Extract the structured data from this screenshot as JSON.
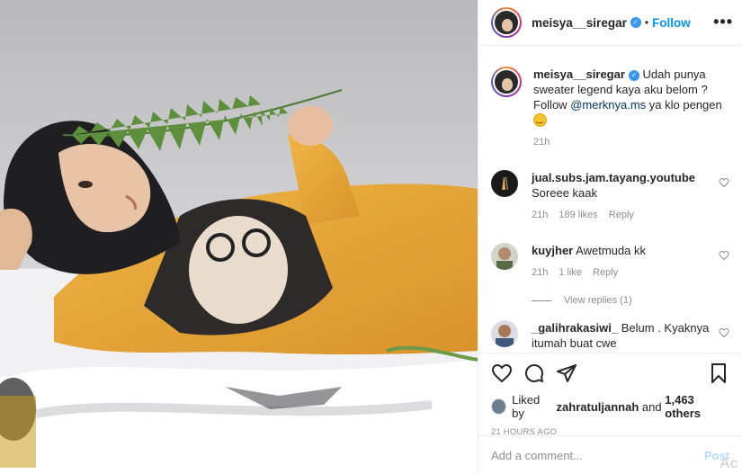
{
  "header": {
    "username": "meisya__siregar",
    "separator": "•",
    "follow_label": "Follow",
    "more_label": "•••"
  },
  "caption": {
    "username": "meisya__siregar",
    "text_before": "Udah punya sweater legend kaya aku belom ? Follow ",
    "mention": "@merknya.ms",
    "text_after": " ya klo pengen",
    "time": "21h"
  },
  "comments": [
    {
      "username": "jual.subs.jam.tayang.youtube",
      "text": "Soreee kaak",
      "time": "21h",
      "likes": "189 likes",
      "reply_label": "Reply"
    },
    {
      "username": "kuyjher",
      "text": "Awetmuda kk",
      "time": "21h",
      "likes": "1 like",
      "reply_label": "Reply",
      "view_replies": "View replies (1)"
    },
    {
      "username": "_galihrakasiwi_",
      "text": "Belum . Kyaknya itumah buat cwe"
    }
  ],
  "likes": {
    "prefix": "Liked by",
    "user": "zahratuljannah",
    "middle": "and",
    "count": "1,463 others"
  },
  "timestamp": "21 HOURS AGO",
  "add_comment": {
    "placeholder": "Add a comment...",
    "post_label": "Post"
  },
  "watermark": "Ac",
  "colors": {
    "accent": "#0095f6",
    "verified": "#3897f0",
    "sweater": "#e8a83a",
    "hijab": "#1f1f22"
  },
  "icons": {
    "like": "heart-icon",
    "comment": "comment-icon",
    "share": "paper-plane-icon",
    "save": "bookmark-icon",
    "options": "more-options-icon"
  }
}
